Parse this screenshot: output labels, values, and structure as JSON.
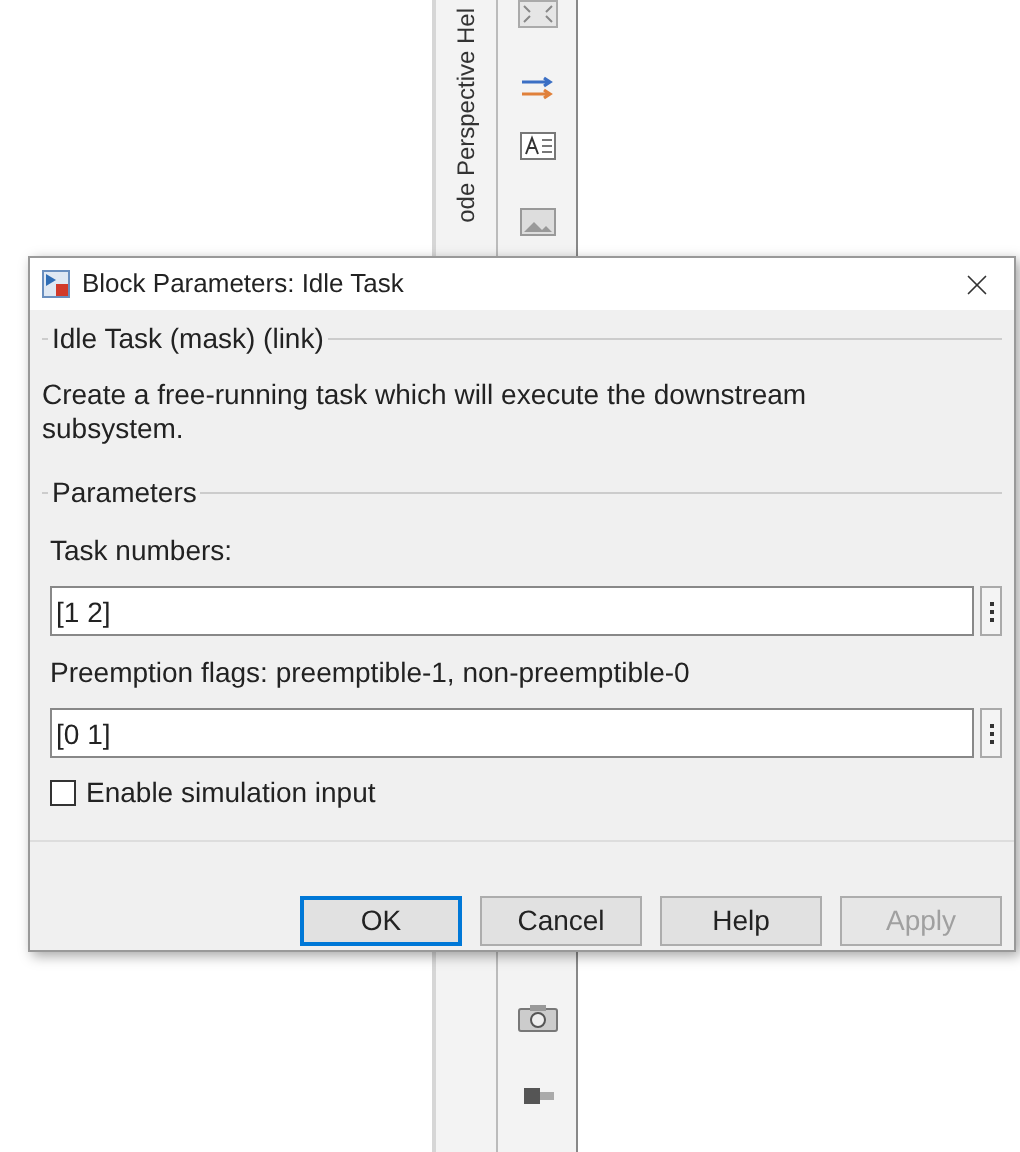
{
  "side_panel": {
    "title": "ode Perspective Hel"
  },
  "dialog": {
    "title": "Block Parameters: Idle Task",
    "mask_group": {
      "title": "Idle Task (mask) (link)",
      "description": "Create a free-running task which will execute the downstream subsystem."
    },
    "parameters": {
      "title": "Parameters",
      "fields": [
        {
          "label": "Task numbers:",
          "value": "[1 2]"
        },
        {
          "label": "Preemption flags: preemptible-1, non-preemptible-0",
          "value": "[0 1]"
        }
      ],
      "checkbox": {
        "label": "Enable simulation input",
        "checked": false
      }
    },
    "buttons": [
      {
        "label": "OK",
        "default": true,
        "disabled": false
      },
      {
        "label": "Cancel",
        "default": false,
        "disabled": false
      },
      {
        "label": "Help",
        "default": false,
        "disabled": false
      },
      {
        "label": "Apply",
        "default": false,
        "disabled": true
      }
    ]
  }
}
